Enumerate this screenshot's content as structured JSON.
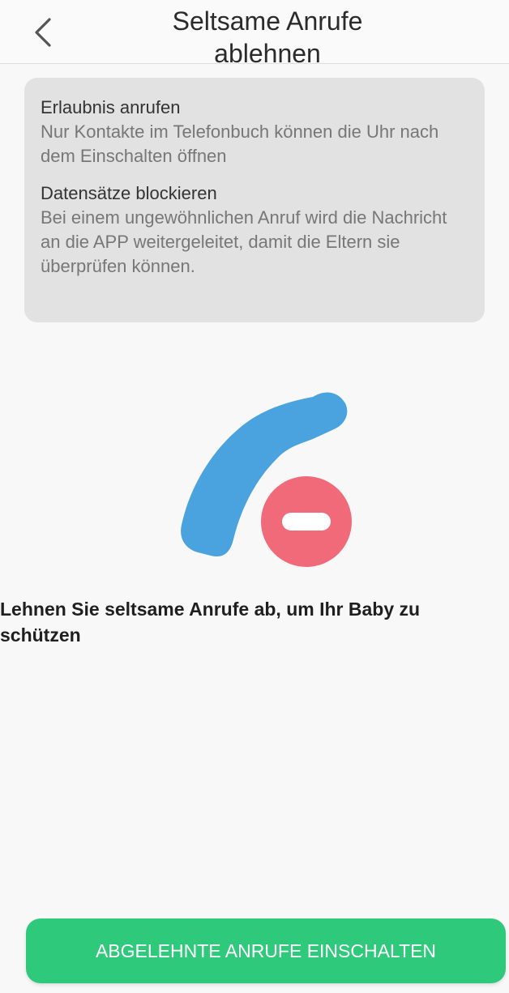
{
  "header": {
    "title_line1": "Seltsame Anrufe",
    "title_line2": "ablehnen"
  },
  "info_card": {
    "sections": [
      {
        "heading": "Erlaubnis anrufen",
        "text": "Nur Kontakte im Telefonbuch können die Uhr nach dem Einschalten öffnen"
      },
      {
        "heading": "Datensätze blockieren",
        "text": "Bei einem ungewöhnlichen Anruf wird die Nachricht an die APP weitergeleitet, damit die Eltern sie überprüfen können."
      }
    ]
  },
  "illustration": {
    "icon": "phone-blocked-icon",
    "phone_color": "#4aa3df",
    "block_color": "#f06a7a"
  },
  "main": {
    "tagline": "Lehnen Sie seltsame Anrufe ab, um Ihr Baby zu schützen"
  },
  "footer": {
    "button_label": "ABGELEHNTE ANRUFE EINSCHALTEN",
    "button_color": "#2ec97a"
  }
}
